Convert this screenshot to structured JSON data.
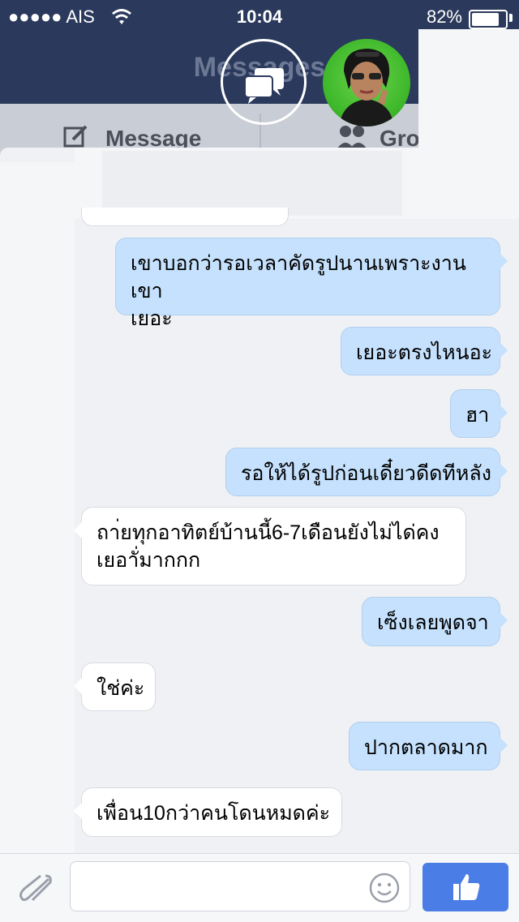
{
  "status_bar": {
    "carrier": "AIS",
    "time": "10:04",
    "battery": "82%",
    "battery_level": 0.82
  },
  "nav": {
    "title": "Messages"
  },
  "segments": {
    "message_label": "Message",
    "groups_label": "Gro"
  },
  "chat": {
    "messages": [
      {
        "side": "out",
        "text_line1": "เขาบอกว่ารอเวลาคัดรูปนานเพราะงานเขา",
        "text_line2": "เยอะ"
      },
      {
        "side": "out",
        "text": "เยอะตรงไหนอะ"
      },
      {
        "side": "out",
        "text": "ฮา"
      },
      {
        "side": "out",
        "text": "รอให้ได้รูปก่อนเดี๋ยวดีดทีหลัง"
      },
      {
        "side": "in",
        "text_line1": "ถา่ยทุกอาทิตย์บ้านนี้6-7เดือนยังไม่ได่คง",
        "text_line2": "เยอาั่มากกก"
      },
      {
        "side": "out",
        "text": "เซ็งเลยพูดจา"
      },
      {
        "side": "in",
        "text": "ใช่ค่ะ"
      },
      {
        "side": "out",
        "text": "ปากตลาดมาก"
      },
      {
        "side": "in",
        "text": "เพื่อน10กว่าคนโดนหมดค่ะ"
      }
    ]
  },
  "composer": {
    "placeholder": ""
  },
  "colors": {
    "nav_bg": "#2b3a5c",
    "outgoing_bubble": "#c5e1fd",
    "incoming_bubble": "#ffffff",
    "like_button": "#4a7ee6"
  },
  "icons": {
    "wifi": "wifi-icon",
    "chat": "chat-bubbles-icon",
    "compose": "compose-icon",
    "groups": "groups-icon",
    "attach": "paperclip-icon",
    "emoji": "smiley-icon",
    "like": "thumbs-up-icon"
  }
}
